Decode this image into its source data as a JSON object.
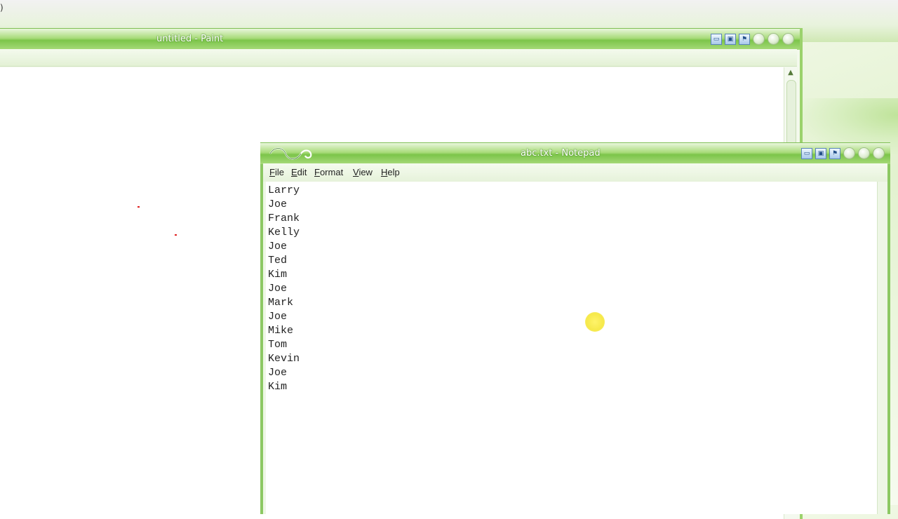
{
  "paint_window": {
    "title": "untitled - Paint"
  },
  "notepad_window": {
    "title": "abc.txt - Notepad",
    "menu": [
      {
        "accel": "F",
        "rest": "ile"
      },
      {
        "accel": "E",
        "rest": "dit"
      },
      {
        "accel": "",
        "rest": "F",
        "post": "ormat"
      },
      {
        "accel": "V",
        "rest": "iew"
      },
      {
        "accel": "H",
        "rest": "elp"
      }
    ],
    "menu_labels": [
      "File",
      "Edit",
      "Format",
      "View",
      "Help"
    ],
    "content_lines": [
      "Larry",
      "Joe",
      "Frank",
      "Kelly",
      "Joe",
      "Ted",
      "Kim",
      "Joe",
      "Mark",
      "Joe",
      "Mike",
      "Tom",
      "Kevin",
      "Joe",
      "Kim"
    ]
  },
  "titlebar_icons": [
    "restore-icon",
    "tile-icon",
    "pin-icon"
  ],
  "colors": {
    "theme_green": "#7cc54a",
    "cursor_highlight": "#f6e94a"
  }
}
